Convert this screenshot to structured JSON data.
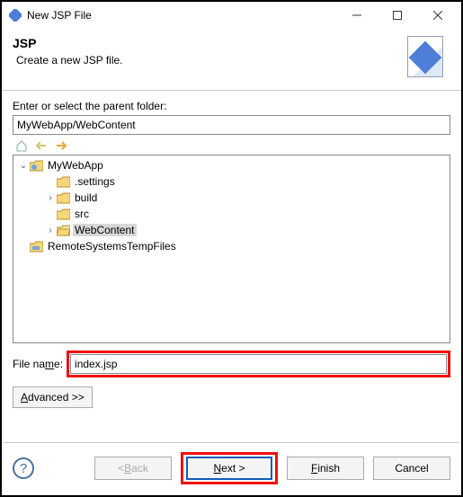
{
  "window": {
    "title": "New JSP File"
  },
  "banner": {
    "title": "JSP",
    "subtitle": "Create a new JSP file."
  },
  "folder_section": {
    "label": "Enter or select the parent folder:",
    "path_value": "MyWebApp/WebContent"
  },
  "tree": {
    "root": {
      "label": "MyWebApp",
      "expanded": true,
      "children": [
        {
          "label": ".settings",
          "expanded": false,
          "leaf": true
        },
        {
          "label": "build",
          "expanded": false,
          "leaf": false
        },
        {
          "label": "src",
          "expanded": false,
          "leaf": true
        },
        {
          "label": "WebContent",
          "expanded": false,
          "leaf": false,
          "selected": true
        }
      ]
    },
    "sibling": {
      "label": "RemoteSystemsTempFiles"
    }
  },
  "filename": {
    "label": "File name:",
    "value": "index.jsp"
  },
  "advanced_label": "Advanced >>",
  "buttons": {
    "back": "< Back",
    "next": "Next >",
    "finish": "Finish",
    "cancel": "Cancel"
  }
}
